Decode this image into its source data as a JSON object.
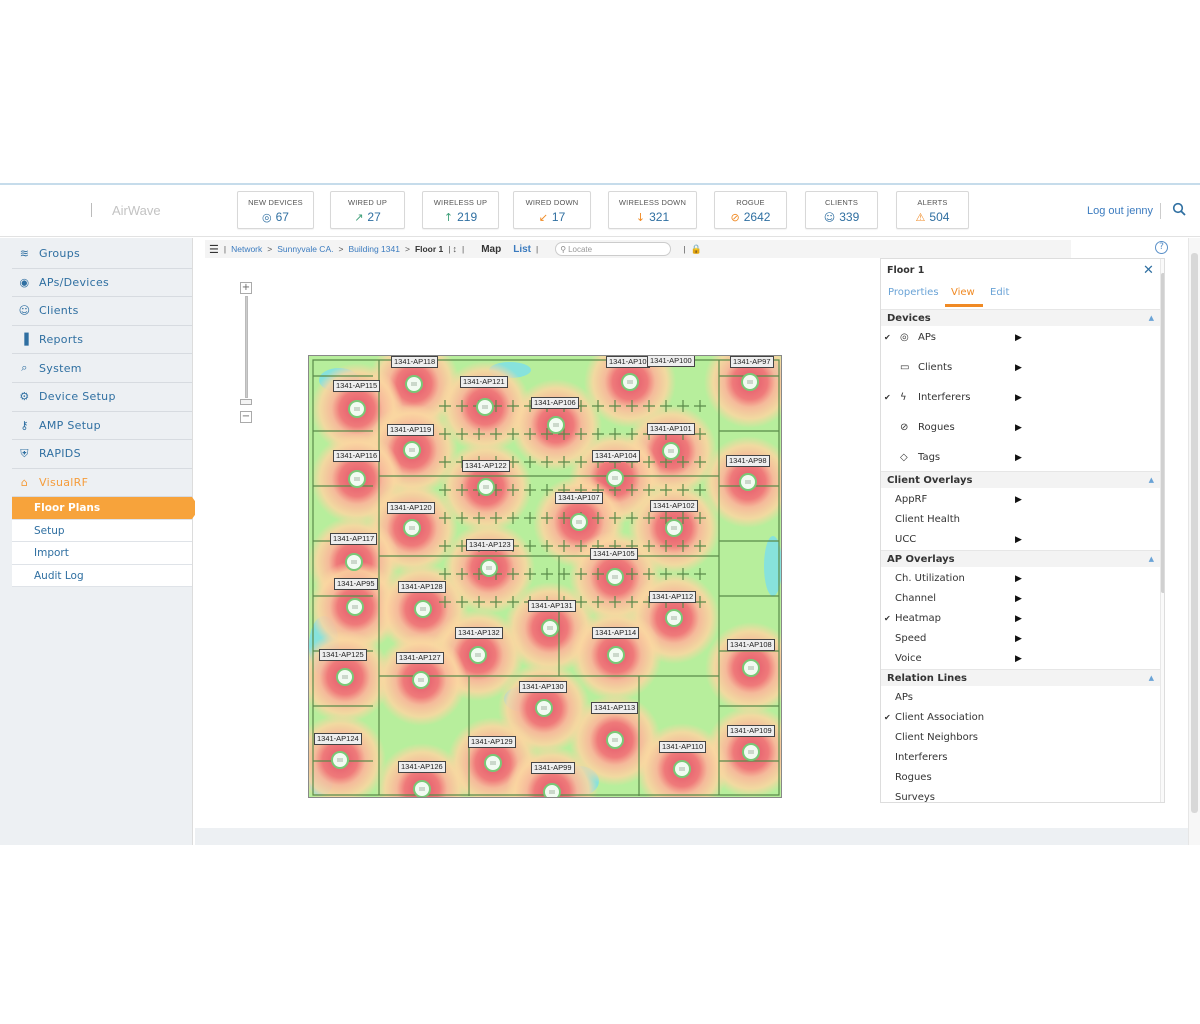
{
  "app": {
    "logo_text": "AirWave"
  },
  "header": {
    "stats": [
      {
        "label": "NEW DEVICES",
        "value": "67",
        "icon": "device-icon",
        "color": "#2f6fa1"
      },
      {
        "label": "WIRED UP",
        "value": "27",
        "icon": "wired-up-icon",
        "color": "#3fa07a"
      },
      {
        "label": "WIRELESS UP",
        "value": "219",
        "icon": "arrow-up-icon",
        "color": "#3fa07a"
      },
      {
        "label": "WIRED DOWN",
        "value": "17",
        "icon": "wired-down-icon",
        "color": "#f08a24"
      },
      {
        "label": "WIRELESS DOWN",
        "value": "321",
        "icon": "arrow-down-icon",
        "color": "#f08a24"
      },
      {
        "label": "ROGUE",
        "value": "2642",
        "icon": "rogue-icon",
        "color": "#f08a24"
      },
      {
        "label": "CLIENTS",
        "value": "339",
        "icon": "user-icon",
        "color": "#2f6fa1"
      },
      {
        "label": "ALERTS",
        "value": "504",
        "icon": "warning-icon",
        "color": "#f08a24"
      }
    ],
    "logout": "Log out jenny"
  },
  "sidebar": {
    "items": [
      {
        "label": "Groups",
        "icon": "wifi-icon"
      },
      {
        "label": "APs/Devices",
        "icon": "eye-icon"
      },
      {
        "label": "Clients",
        "icon": "users-icon"
      },
      {
        "label": "Reports",
        "icon": "bar-chart-icon"
      },
      {
        "label": "System",
        "icon": "magnifier-icon"
      },
      {
        "label": "Device Setup",
        "icon": "device-setup-icon"
      },
      {
        "label": "AMP Setup",
        "icon": "key-icon"
      },
      {
        "label": "RAPIDS",
        "icon": "shield-icon"
      },
      {
        "label": "VisualRF",
        "icon": "building-icon"
      }
    ],
    "subitems": [
      "Floor Plans",
      "Setup",
      "Import",
      "Audit Log"
    ]
  },
  "breadcrumb": {
    "network": "Network",
    "site": "Sunnyvale CA.",
    "building": "Building 1341",
    "floor": "Floor 1",
    "map_tab": "Map",
    "list_tab": "List",
    "locate_placeholder": "Locate"
  },
  "panel": {
    "title": "Floor 1",
    "tabs": [
      "Properties",
      "View",
      "Edit"
    ],
    "devices_title": "Devices",
    "devices": [
      {
        "label": "APs",
        "checked": true,
        "icon": "ap-icon"
      },
      {
        "label": "Clients",
        "checked": false,
        "icon": "monitor-icon"
      },
      {
        "label": "Interferers",
        "checked": true,
        "icon": "lightning-icon"
      },
      {
        "label": "Rogues",
        "checked": false,
        "icon": "rogue-icon"
      },
      {
        "label": "Tags",
        "checked": false,
        "icon": "tag-icon"
      }
    ],
    "client_overlays_title": "Client Overlays",
    "client_overlays": [
      {
        "label": "AppRF",
        "arrow": true
      },
      {
        "label": "Client Health",
        "arrow": false
      },
      {
        "label": "UCC",
        "arrow": true
      }
    ],
    "ap_overlays_title": "AP Overlays",
    "ap_overlays": [
      {
        "label": "Ch. Utilization",
        "checked": false
      },
      {
        "label": "Channel",
        "checked": false
      },
      {
        "label": "Heatmap",
        "checked": true
      },
      {
        "label": "Speed",
        "checked": false
      },
      {
        "label": "Voice",
        "checked": false
      }
    ],
    "relation_title": "Relation Lines",
    "relation_lines": [
      {
        "label": "APs",
        "checked": false
      },
      {
        "label": "Client Association",
        "checked": true
      },
      {
        "label": "Client Neighbors",
        "checked": false
      },
      {
        "label": "Interferers",
        "checked": false
      },
      {
        "label": "Rogues",
        "checked": false
      },
      {
        "label": "Surveys",
        "checked": false
      }
    ]
  },
  "map": {
    "aps": [
      "1341-AP118",
      "1341-AP10",
      "1341-AP100",
      "1341-AP97",
      "1341-AP115",
      "1341-AP121",
      "1341-AP106",
      "1341-AP119",
      "1341-AP101",
      "1341-AP116",
      "1341-AP122",
      "1341-AP104",
      "1341-AP98",
      "1341-AP107",
      "1341-AP120",
      "1341-AP102",
      "1341-AP117",
      "1341-AP123",
      "1341-AP105",
      "1341-AP95",
      "1341-AP128",
      "1341-AP112",
      "1341-AP131",
      "1341-AP132",
      "1341-AP114",
      "1341-AP125",
      "1341-AP127",
      "1341-AP108",
      "1341-AP130",
      "1341-AP113",
      "1341-AP124",
      "1341-AP129",
      "1341-AP109",
      "1341-AP110",
      "1341-AP126",
      "1341-AP99"
    ]
  }
}
